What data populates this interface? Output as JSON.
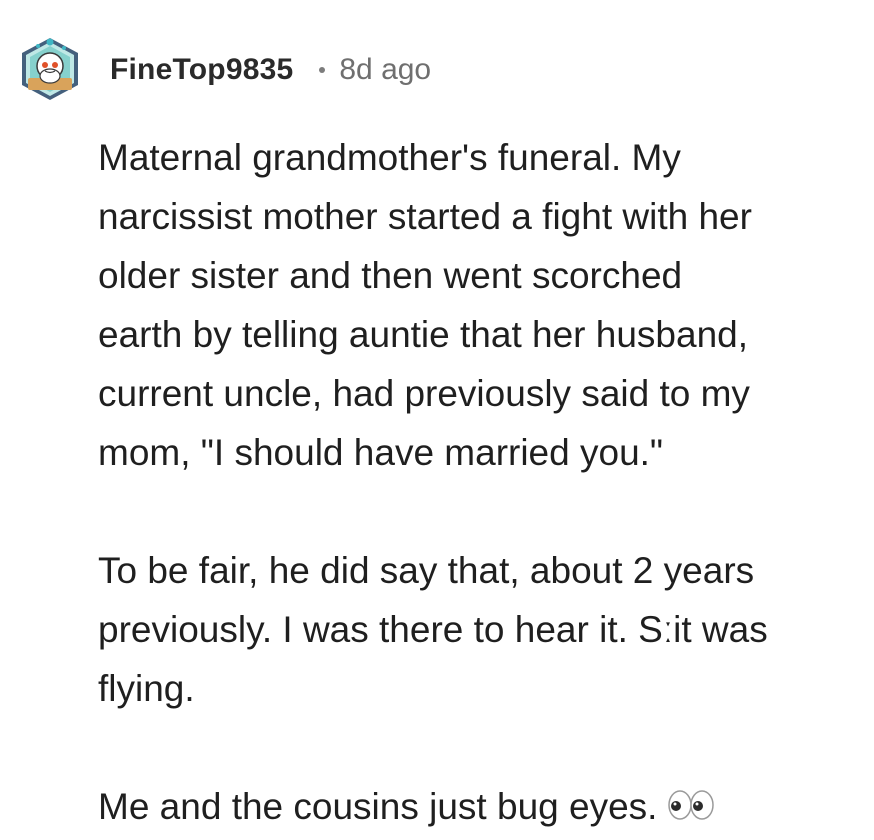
{
  "comment": {
    "username": "FineTop9835",
    "timestamp": "8d ago",
    "avatar_icon": "snoo-avatar-icon",
    "paragraphs": [
      "Maternal grandmother's funeral. My\nnarcissist mother started a fight with her\nolder sister and then went scorched\nearth by telling auntie that her husband,\ncurrent uncle, had previously said to my\nmom, \"I should have married you.\"",
      "To be fair, he did say that, about 2 years\npreviously. I was there to hear it. Sːit was\nflying.",
      "Me and the cousins just bug eyes."
    ],
    "emoji_icon": "eyes-emoji-icon"
  },
  "colors": {
    "username": "#2a2a2a",
    "timestamp": "#6f6f6f",
    "text": "#1f1f1f",
    "avatar_teal": "#7fd1cf",
    "avatar_hex": "#4a6b8a"
  }
}
